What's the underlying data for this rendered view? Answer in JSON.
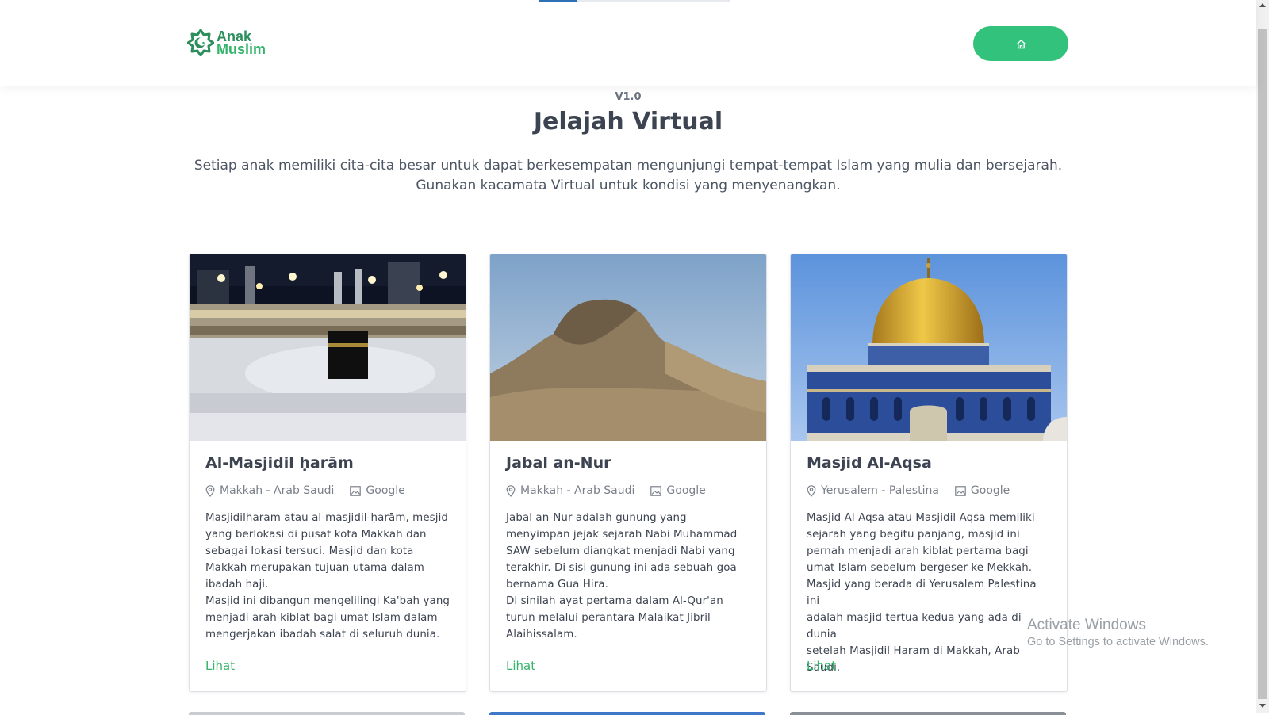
{
  "header": {
    "logo": {
      "line1": "Anak",
      "line2": "Muslim"
    },
    "home_button_icon": "home-icon",
    "reading_progress": 0.2
  },
  "hero": {
    "version": "V1.0",
    "title": "Jelajah Virtual",
    "description_lines": [
      "Setiap anak memiliki cita-cita besar untuk dapat berkesempatan mengunjungi tempat-tempat Islam yang mulia dan bersejarah.",
      "Gunakan kacamata Virtual untuk kondisi yang menyenangkan."
    ]
  },
  "cards": [
    {
      "title": "Al-Masjidil ḥarām",
      "location": "Makkah - Arab Saudi",
      "source": "Google",
      "description_lines": [
        "Masjidilharam atau al-masjidil-ḥarām, mesjid",
        "yang berlokasi di pusat kota Makkah dan",
        "sebagai lokasi tersuci. Masjid dan kota",
        "Makkah merupakan tujuan utama dalam",
        "ibadah haji.",
        "Masjid ini dibangun mengelilingi Ka'bah yang",
        "menjadi arah kiblat bagi umat Islam dalam",
        "mengerjakan ibadah salat di seluruh dunia."
      ],
      "link": "Lihat"
    },
    {
      "title": "Jabal an-Nur",
      "location": "Makkah - Arab Saudi",
      "source": "Google",
      "description_lines": [
        "Jabal an-Nur adalah gunung yang",
        "menyimpan jejak sejarah Nabi Muhammad",
        "SAW sebelum diangkat menjadi Nabi yang",
        "terakhir. Di sisi gunung ini ada sebuah goa",
        "bernama Gua Hira.",
        "Di sinilah ayat pertama dalam Al-Qur'an",
        "turun melalui perantara Malaikat Jibril",
        "Alaihissalam."
      ],
      "link": "Lihat"
    },
    {
      "title": "Masjid Al-Aqsa",
      "location": "Yerusalem - Palestina",
      "source": "Google",
      "description_lines": [
        "Masjid Al Aqsa atau Masjidil Aqsa memiliki",
        "sejarah yang begitu panjang, masjid ini",
        "pernah menjadi arah kiblat pertama bagi",
        "umat Islam sebelum bergeser ke Mekkah.",
        "Masjid yang berada di Yerusalem Palestina ini",
        "adalah masjid tertua kedua yang ada di dunia",
        "setelah Masjidil Haram di Makkah, Arab",
        "Saudi."
      ],
      "link": "Lihat"
    }
  ],
  "watermark": {
    "title": "Activate Windows",
    "subtitle": "Go to Settings to activate Windows."
  },
  "colors": {
    "accent": "#33c27b",
    "text": "#3d4451",
    "muted": "#7a808a"
  }
}
